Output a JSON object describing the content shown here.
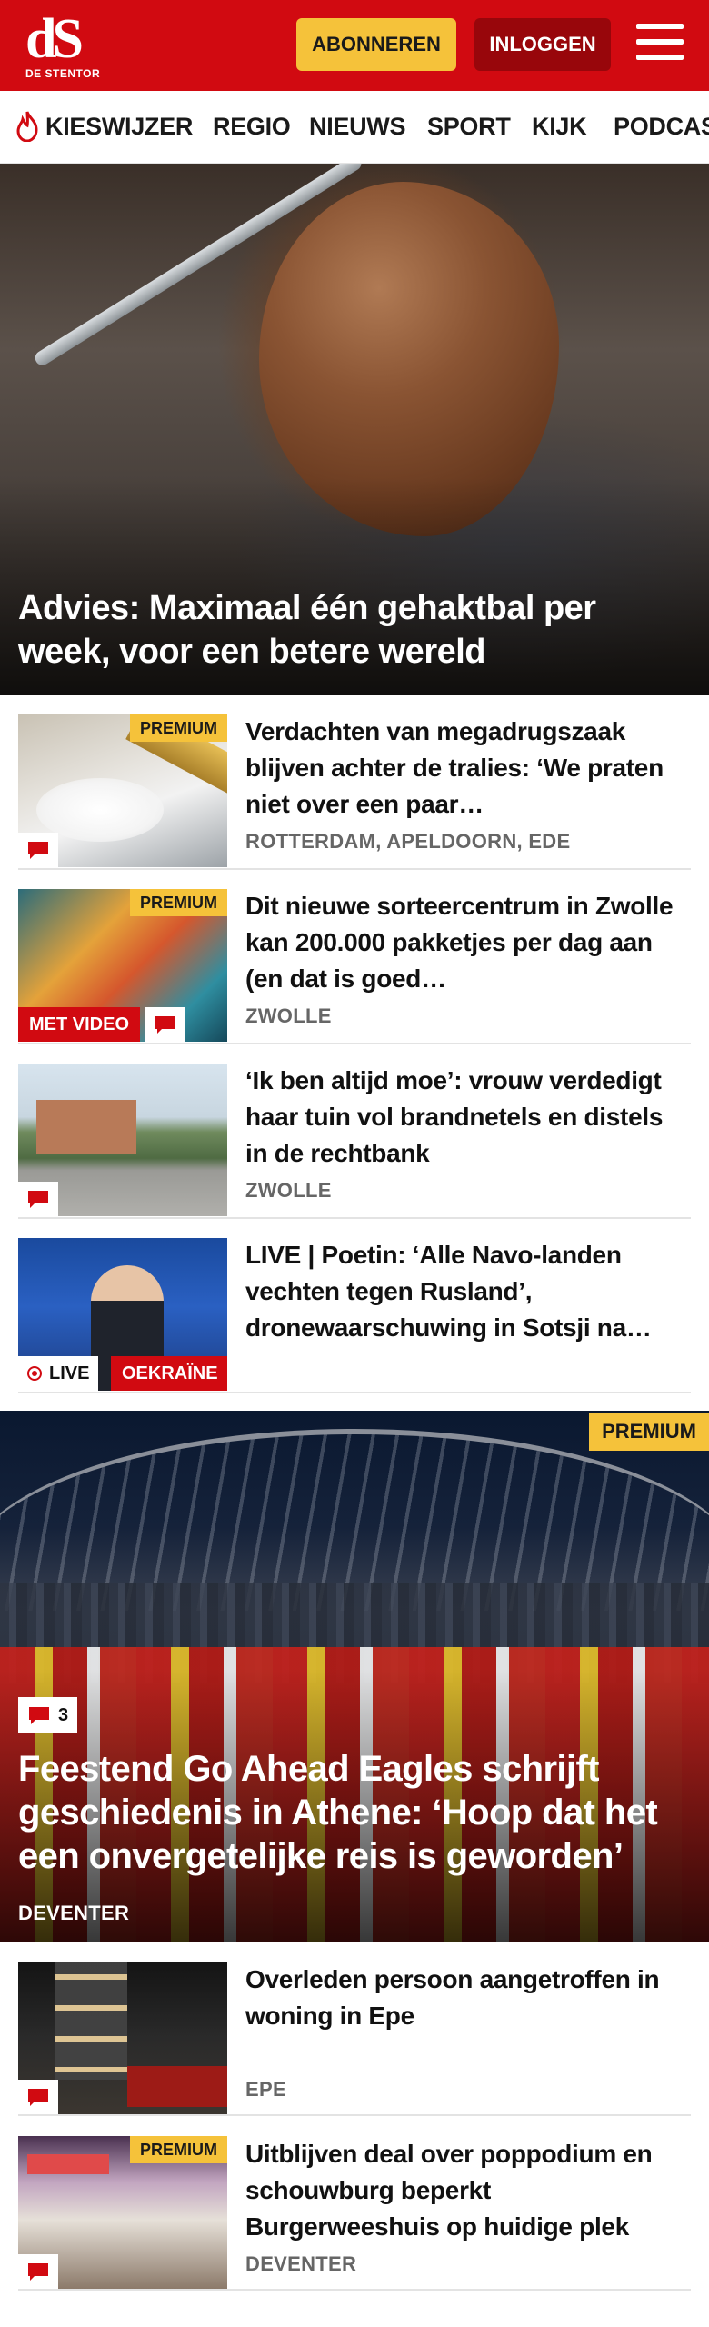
{
  "header": {
    "logo": "dS",
    "logo_subtitle": "DE STENTOR",
    "subscribe_label": "ABONNEREN",
    "login_label": "INLOGGEN"
  },
  "nav": {
    "items": [
      "KIESWIJZER",
      "REGIO",
      "NIEUWS",
      "SPORT",
      "KIJK",
      "PODCAST"
    ]
  },
  "hero": {
    "title": "Advies: Maximaal één gehaktbal per week, voor een betere wereld"
  },
  "articles": [
    {
      "title": "Verdachten van megadrugszaak blijven achter de tralies: ‘We praten niet over een paar…",
      "meta": "ROTTERDAM, APELDOORN, EDE",
      "premium": "PREMIUM"
    },
    {
      "title": "Dit nieuwe sorteercentrum in Zwolle kan 200.000 pakketjes per dag aan (en dat is goed…",
      "meta": "ZWOLLE",
      "premium": "PREMIUM",
      "video_label": "MET VIDEO"
    },
    {
      "title": "‘Ik ben altijd moe’: vrouw verdedigt haar tuin vol brandne­tels en distels in de rechtbank",
      "meta": "ZWOLLE"
    },
    {
      "title": "LIVE | Poetin: ‘Alle Navo-landen vechten tegen Rusland’, dronewaarschuwing in Sotsji na…",
      "live_label": "LIVE",
      "topic_label": "OEKRAÏNE"
    }
  ],
  "feature": {
    "premium": "PREMIUM",
    "comment_count": "3",
    "title": "Feestend Go Ahead Eagles schrijft geschiedenis in Athene: ‘Hoop dat het een onvergetelijke reis is geworden’",
    "meta": "DEVENTER"
  },
  "articles_bottom": [
    {
      "title": "Overleden persoon aangetroffen in woning in Epe",
      "meta": "EPE"
    },
    {
      "title": "Uitblijven deal over poppodium en schouwburg beperkt Burgerweeshuis op huidige plek",
      "meta": "DEVENTER",
      "premium": "PREMIUM"
    }
  ],
  "colors": {
    "brand_red": "#d10a11",
    "login_red": "#98060b",
    "premium_yellow": "#f5c23a",
    "meta_gray": "#666666"
  },
  "icons": [
    "menu-icon",
    "flame-icon",
    "comment-icon",
    "live-dot-icon"
  ]
}
